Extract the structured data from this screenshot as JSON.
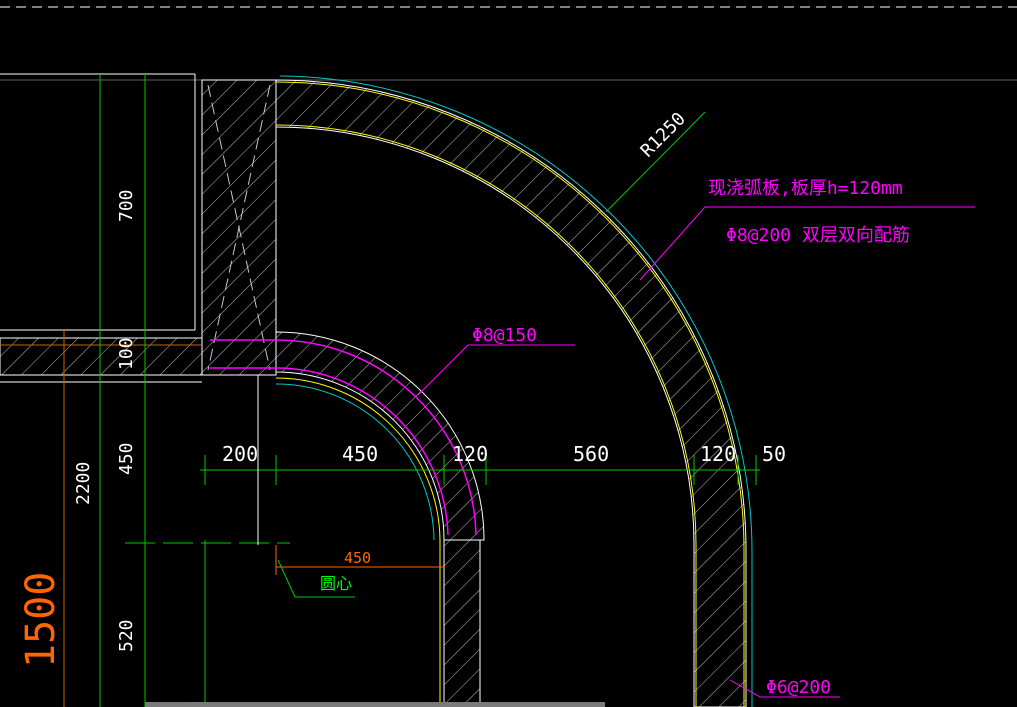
{
  "colors": {
    "background": "#000000",
    "outline_white": "#ffffff",
    "yellow": "#ffff00",
    "cyan": "#00c8c8",
    "green": "#00ff00",
    "magenta": "#ff00ff",
    "orange": "#ff6600",
    "hatch": "#c8c8c8"
  },
  "dimensions": {
    "horizontal": [
      "200",
      "450",
      "120",
      "560",
      "120",
      "50"
    ],
    "vertical": [
      "700",
      "100",
      "450",
      "2200",
      "520"
    ],
    "inner_radius": "450",
    "big_vertical": "1500"
  },
  "labels": {
    "radius": "R1250",
    "slab_note": "现浇弧板,板厚h=120mm",
    "slab_rebar": "Φ8@200 双层双向配筋",
    "inner_rebar": "Φ8@150",
    "center_label": "圆心",
    "bottom_rebar": "Φ6@200"
  }
}
